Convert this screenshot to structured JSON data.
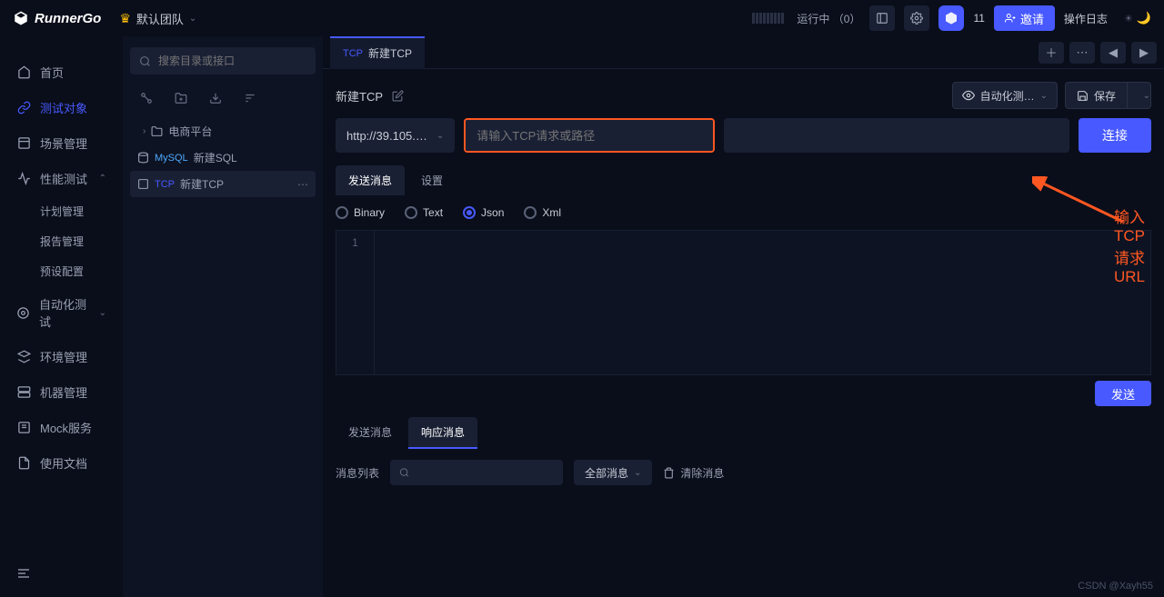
{
  "header": {
    "logo": "RunnerGo",
    "team": "默认团队",
    "running": "运行中",
    "running_count": "（0）",
    "user_count": "11",
    "invite": "邀请",
    "ops_log": "操作日志"
  },
  "sidebar": {
    "items": [
      {
        "label": "首页"
      },
      {
        "label": "测试对象"
      },
      {
        "label": "场景管理"
      },
      {
        "label": "性能测试",
        "expandable": true,
        "subs": [
          "计划管理",
          "报告管理",
          "预设配置"
        ]
      },
      {
        "label": "自动化测试",
        "expandable": true
      },
      {
        "label": "环境管理"
      },
      {
        "label": "机器管理"
      },
      {
        "label": "Mock服务"
      },
      {
        "label": "使用文档"
      }
    ]
  },
  "tree": {
    "search_placeholder": "搜索目录或接口",
    "folder": "电商平台",
    "items": [
      {
        "tag": "MySQL",
        "name": "新建SQL"
      },
      {
        "tag": "TCP",
        "name": "新建TCP",
        "selected": true
      }
    ]
  },
  "main": {
    "tab_tag": "TCP",
    "tab_name": "新建TCP",
    "title": "新建TCP",
    "auto_select": "自动化测…",
    "save": "保存",
    "url_select": "http://39.105.…",
    "url_placeholder": "请输入TCP请求或路径",
    "connect": "连接",
    "sub_tabs": [
      "发送消息",
      "设置"
    ],
    "radios": [
      "Binary",
      "Text",
      "Json",
      "Xml"
    ],
    "radio_selected": 2,
    "line_no": "1",
    "send": "发送",
    "resp_tabs": [
      "发送消息",
      "响应消息"
    ],
    "msg_list_label": "消息列表",
    "filter_label": "全部消息",
    "clear_label": "清除消息"
  },
  "annotation": "输入 TCP 请求 URL",
  "watermark": "CSDN @Xayh55"
}
